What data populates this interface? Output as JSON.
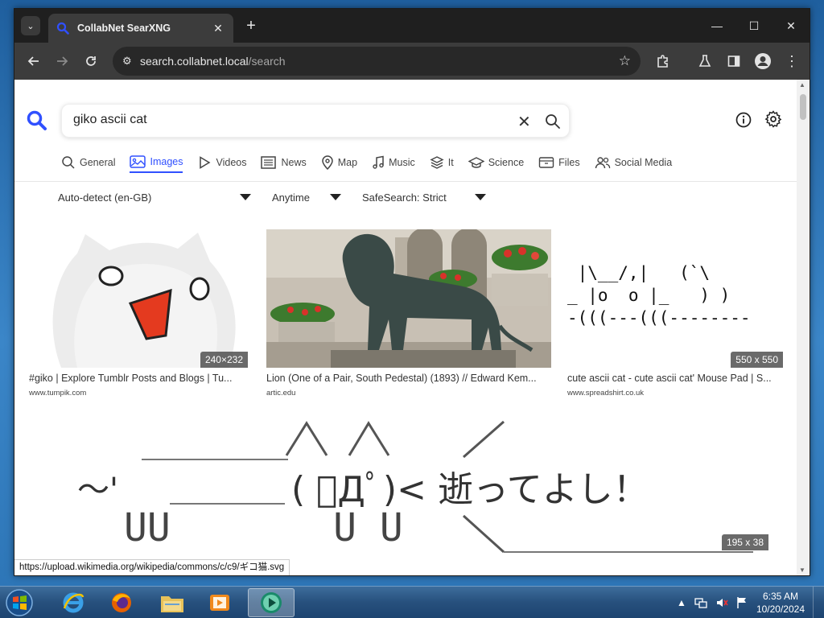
{
  "browser": {
    "tab_title": "CollabNet SearXNG",
    "url_host": "search.collabnet.local",
    "url_path": "/search"
  },
  "search": {
    "query": "giko ascii cat"
  },
  "categories": [
    {
      "label": "General",
      "icon": "search-icon"
    },
    {
      "label": "Images",
      "icon": "image-icon",
      "active": true
    },
    {
      "label": "Videos",
      "icon": "play-icon"
    },
    {
      "label": "News",
      "icon": "newspaper-icon"
    },
    {
      "label": "Map",
      "icon": "map-pin-icon"
    },
    {
      "label": "Music",
      "icon": "music-note-icon"
    },
    {
      "label": "It",
      "icon": "layers-icon"
    },
    {
      "label": "Science",
      "icon": "graduation-cap-icon"
    },
    {
      "label": "Files",
      "icon": "file-box-icon"
    },
    {
      "label": "Social Media",
      "icon": "people-icon"
    }
  ],
  "filters": {
    "language": "Auto-detect (en-GB)",
    "time": "Anytime",
    "safesearch": "SafeSearch: Strict"
  },
  "results": [
    {
      "title": "#giko | Explore Tumblr Posts and Blogs | Tu...",
      "url": "www.tumpik.com",
      "dims": "240×232"
    },
    {
      "title": "Lion (One of a Pair, South Pedestal) (1893) // Edward Kem...",
      "url": "artic.edu",
      "dims": ""
    },
    {
      "title": "cute ascii cat - cute ascii cat' Mouse Pad | S...",
      "url": "www.spreadshirt.co.uk",
      "dims": "550 x 550",
      "ascii": " |\\__/,|   (`\\\n_ |o  o |_   ) )\n-(((---(((--------"
    },
    {
      "title": "",
      "url": "",
      "dims": "195 x 38",
      "ascii_main": "(  ﾟДﾟ)<  逝ってよし！",
      "ascii_left": "～'",
      "ascii_legs": "UU       U U"
    }
  ],
  "status_url": "https://upload.wikimedia.org/wikipedia/commons/c/c9/ギコ猫.svg",
  "taskbar": {
    "time": "6:35 AM",
    "date": "10/20/2024"
  }
}
